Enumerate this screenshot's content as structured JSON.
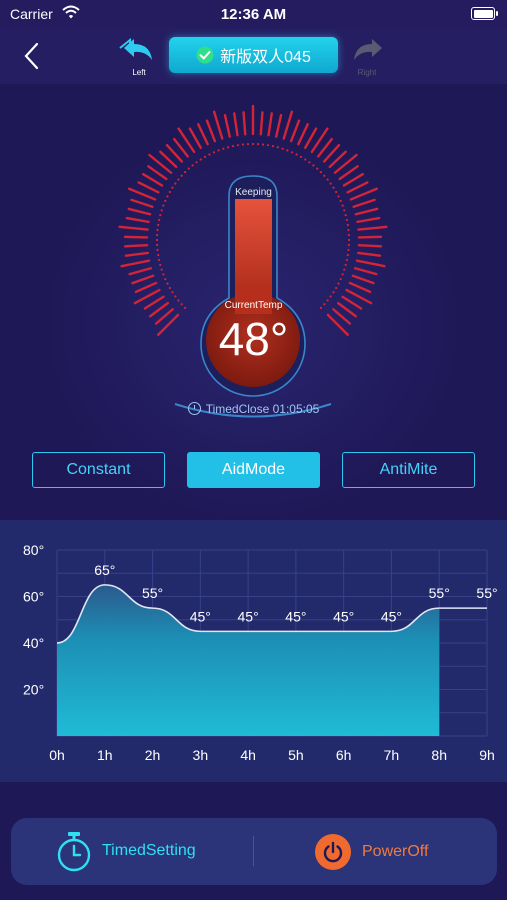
{
  "status_bar": {
    "carrier": "Carrier",
    "time": "12:36 AM"
  },
  "nav": {
    "back_icon": "chevron-left-icon",
    "prev_label": "Left",
    "next_label": "Right",
    "device_name": "新版双人045",
    "accent": "#1cc2e6"
  },
  "gauge": {
    "status": "Keeping",
    "current_temp_label": "CurrentTemp",
    "current_temp": "48°",
    "timer_text": "TimedClose 01:05:05",
    "fill_color": "#c03422"
  },
  "modes": [
    {
      "label": "Constant",
      "active": false
    },
    {
      "label": "AidMode",
      "active": true
    },
    {
      "label": "AntiMite",
      "active": false
    }
  ],
  "chart_data": {
    "type": "area",
    "x": [
      "0h",
      "1h",
      "2h",
      "3h",
      "4h",
      "5h",
      "6h",
      "7h",
      "8h",
      "9h"
    ],
    "y_ticks": [
      "20°",
      "40°",
      "60°",
      "80°"
    ],
    "ylim": [
      0,
      80
    ],
    "values": [
      40,
      65,
      55,
      45,
      45,
      45,
      45,
      45,
      55,
      55
    ],
    "point_labels": [
      "",
      "65°",
      "55°",
      "45°",
      "45°",
      "45°",
      "45°",
      "45°",
      "55°",
      "55°"
    ],
    "grid": true,
    "fill_color": "#1fc3dc"
  },
  "bottom": {
    "timed_setting_label": "TimedSetting",
    "power_off_label": "PowerOff",
    "timer_icon": "stopwatch-icon",
    "power_icon": "power-icon"
  }
}
